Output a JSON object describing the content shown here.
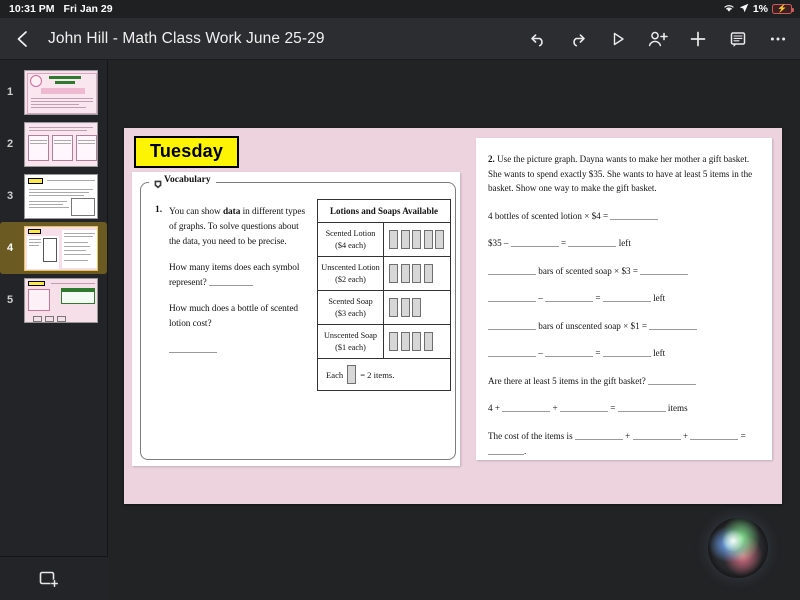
{
  "status_bar": {
    "time": "10:31 PM",
    "date": "Fri Jan 29",
    "battery_percent": "1%",
    "wifi_icon": "wifi-icon",
    "location_icon": "location-arrow-icon",
    "battery_icon": "battery-charging-icon",
    "battery_color": "#d05a5a"
  },
  "header": {
    "back_icon": "chevron-left-icon",
    "title": "John Hill - Math Class Work June 25-29",
    "tools": [
      {
        "name": "undo-button",
        "icon": "undo-icon"
      },
      {
        "name": "redo-button",
        "icon": "redo-icon"
      },
      {
        "name": "present-button",
        "icon": "play-triangle-icon"
      },
      {
        "name": "add-collaborator-button",
        "icon": "person-plus-icon"
      },
      {
        "name": "insert-button",
        "icon": "plus-icon"
      },
      {
        "name": "comments-button",
        "icon": "comment-bubble-icon"
      },
      {
        "name": "more-options-button",
        "icon": "ellipsis-icon"
      }
    ]
  },
  "sidebar": {
    "add_slide_icon": "add-slide-icon",
    "selected_index": 4,
    "thumbnails": [
      {
        "number": "1",
        "selected": false
      },
      {
        "number": "2",
        "selected": false
      },
      {
        "number": "3",
        "selected": false
      },
      {
        "number": "4",
        "selected": true
      },
      {
        "number": "5",
        "selected": false
      }
    ]
  },
  "slide": {
    "background_color": "#ecd3de",
    "day_banner": "Tuesday",
    "banner_fill": "#fdf404",
    "vocabulary_label": "Vocabulary",
    "vocabulary_icon": "shield-bookmark-icon",
    "question1": {
      "number": "1.",
      "paragraph_pre": "You can show ",
      "paragraph_bold": "data",
      "paragraph_post": " in different types of graphs. To solve questions about the data, you need to be precise.",
      "prompt1": "How many items does each symbol represent?",
      "prompt2": "How much does a bottle of scented lotion cost?"
    },
    "picture_graph": {
      "title": "Lotions and Soaps Available",
      "rows": [
        {
          "label_line1": "Scented Lotion",
          "label_line2": "($4 each)",
          "symbols": 5
        },
        {
          "label_line1": "Unscented Lotion",
          "label_line2": "($2 each)",
          "symbols": 4
        },
        {
          "label_line1": "Scented Soap",
          "label_line2": "($3 each)",
          "symbols": 3
        },
        {
          "label_line1": "Unscented Soap",
          "label_line2": "($1 each)",
          "symbols": 4
        }
      ],
      "key_prefix": "Each",
      "key_suffix": "= 2 items."
    },
    "question2": {
      "number": "2.",
      "paragraph": "Use the picture graph. Dayna wants to make her mother a gift basket. She wants to spend exactly $35. She wants to have at least 5 items in the basket. Show one way to make the gift basket.",
      "line1_a": "4 bottles of scented lotion",
      "line1_b": "× $4 =",
      "line2_a": "$35 –",
      "line2_b": "=",
      "line2_c": "left",
      "line3_b": "bars of scented soap",
      "line3_c": "× $3 =",
      "line4_b": "–",
      "line4_c": "=",
      "line4_d": "left",
      "line5_b": "bars of unscented soap",
      "line5_c": "× $1 =",
      "line6_b": "–",
      "line6_c": "=",
      "line6_d": "left",
      "line7": "Are there at least 5 items in the gift basket?",
      "line8_a": "4 +",
      "line8_b": "+",
      "line8_c": "=",
      "line8_d": "items",
      "line9_a": "The cost of the items is",
      "line9_b": "+",
      "line9_c": "+",
      "line9_d": "=",
      "line9_e": "."
    }
  },
  "assistant": {
    "name": "siri-orb",
    "visible": true
  }
}
